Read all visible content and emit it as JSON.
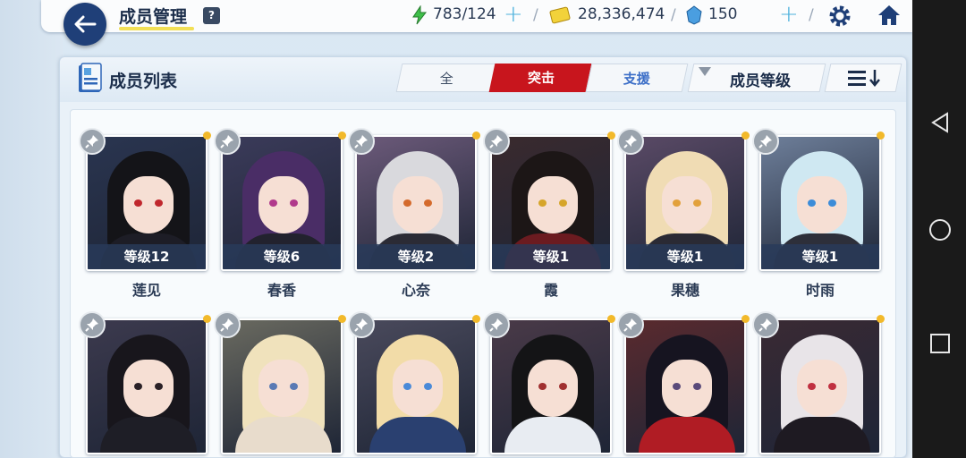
{
  "header": {
    "title": "成员管理",
    "help": "?",
    "stamina": "783/124",
    "credits": "28,336,474",
    "gems": "150"
  },
  "panel": {
    "title": "成员列表",
    "filters": {
      "all": "全",
      "assault": "突击",
      "support": "支援"
    },
    "sort_label": "成员等级"
  },
  "students": [
    {
      "name": "莲见",
      "level": "等级12",
      "bg": "#2a3550",
      "hair": "#141418",
      "eye": "#c0272d",
      "outfit": "#1d1d26"
    },
    {
      "name": "春香",
      "level": "等级6",
      "bg": "#3b3b5a",
      "hair": "#4a2d66",
      "eye": "#b03a8c",
      "outfit": "#22222e"
    },
    {
      "name": "心奈",
      "level": "等级2",
      "bg": "#6c5a7a",
      "hair": "#d9d9dd",
      "eye": "#d46a2c",
      "outfit": "#2b2b35"
    },
    {
      "name": "霞",
      "level": "等级1",
      "bg": "#3a2a2e",
      "hair": "#1c1616",
      "eye": "#d6a52a",
      "outfit": "#6b1b20"
    },
    {
      "name": "果穗",
      "level": "等级1",
      "bg": "#5a4a66",
      "hair": "#f0dcb4",
      "eye": "#e2a13c",
      "outfit": "#2a2a34"
    },
    {
      "name": "时雨",
      "level": "等级1",
      "bg": "#6e7f9a",
      "hair": "#cfe8f2",
      "eye": "#3c8cd8",
      "outfit": "#2d2f3a"
    },
    {
      "name": "",
      "level": "",
      "bg": "#3c3a4e",
      "hair": "#18161c",
      "eye": "#2a2026",
      "outfit": "#1e1e26"
    },
    {
      "name": "",
      "level": "",
      "bg": "#6a6a60",
      "hair": "#f0e2bc",
      "eye": "#5a7ab4",
      "outfit": "#e8dccc"
    },
    {
      "name": "",
      "level": "",
      "bg": "#4a4a5c",
      "hair": "#f2dca8",
      "eye": "#4a8ad8",
      "outfit": "#2a4070"
    },
    {
      "name": "",
      "level": "",
      "bg": "#4a3a48",
      "hair": "#141416",
      "eye": "#a03030",
      "outfit": "#e8ecf2"
    },
    {
      "name": "",
      "level": "",
      "bg": "#5a2a2e",
      "hair": "#161420",
      "eye": "#5a4a7a",
      "outfit": "#b01c24"
    },
    {
      "name": "",
      "level": "",
      "bg": "#3a2a34",
      "hair": "#e8e4e8",
      "eye": "#c03040",
      "outfit": "#1e1a22"
    }
  ],
  "icons": {
    "back": "back-arrow-icon",
    "stamina": "lightning-icon",
    "credits": "credit-card-icon",
    "gems": "gem-icon",
    "settings": "gear-icon",
    "home": "home-icon",
    "pin": "pin-icon"
  },
  "colors": {
    "accent_red": "#c8151d",
    "support_blue": "#3b6ec7",
    "header_navy": "#1f3f78",
    "plus_cyan": "#4bb0dc",
    "stamina_green": "#3fbf4a",
    "credit_yellow": "#f2d23a",
    "gem_blue": "#4a9ee0"
  }
}
